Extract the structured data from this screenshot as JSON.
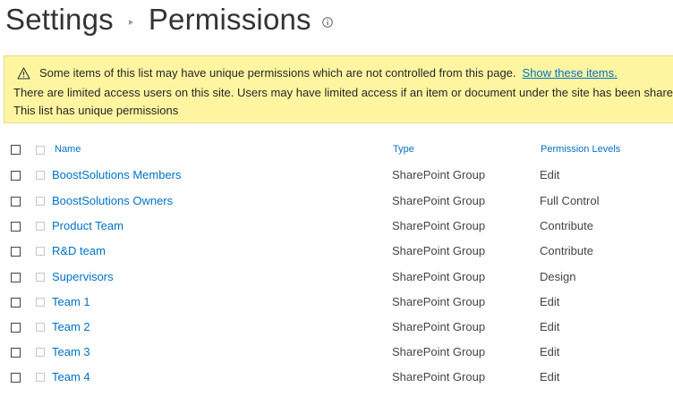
{
  "header": {
    "crumb1": "Settings",
    "crumb2": "Permissions"
  },
  "banner": {
    "line1_text": "Some items of this list may have unique permissions which are not controlled from this page.",
    "line1_link": "Show these items.",
    "line2_text": "There are limited access users on this site. Users may have limited access if an item or document under the site has been shared w",
    "line3_text": "This list has unique permissions",
    "background": "#fff5a1"
  },
  "table": {
    "headers": {
      "name": "Name",
      "type": "Type",
      "levels": "Permission Levels"
    },
    "rows": [
      {
        "name": "BoostSolutions Members",
        "type": "SharePoint Group",
        "level": "Edit"
      },
      {
        "name": "BoostSolutions Owners",
        "type": "SharePoint Group",
        "level": "Full Control"
      },
      {
        "name": "Product Team",
        "type": "SharePoint Group",
        "level": "Contribute"
      },
      {
        "name": "R&D team",
        "type": "SharePoint Group",
        "level": "Contribute"
      },
      {
        "name": "Supervisors",
        "type": "SharePoint Group",
        "level": "Design"
      },
      {
        "name": "Team 1",
        "type": "SharePoint Group",
        "level": "Edit"
      },
      {
        "name": "Team 2",
        "type": "SharePoint Group",
        "level": "Edit"
      },
      {
        "name": "Team 3",
        "type": "SharePoint Group",
        "level": "Edit"
      },
      {
        "name": "Team 4",
        "type": "SharePoint Group",
        "level": "Edit"
      }
    ]
  },
  "colors": {
    "link": "#0072c6",
    "text": "#444444"
  }
}
